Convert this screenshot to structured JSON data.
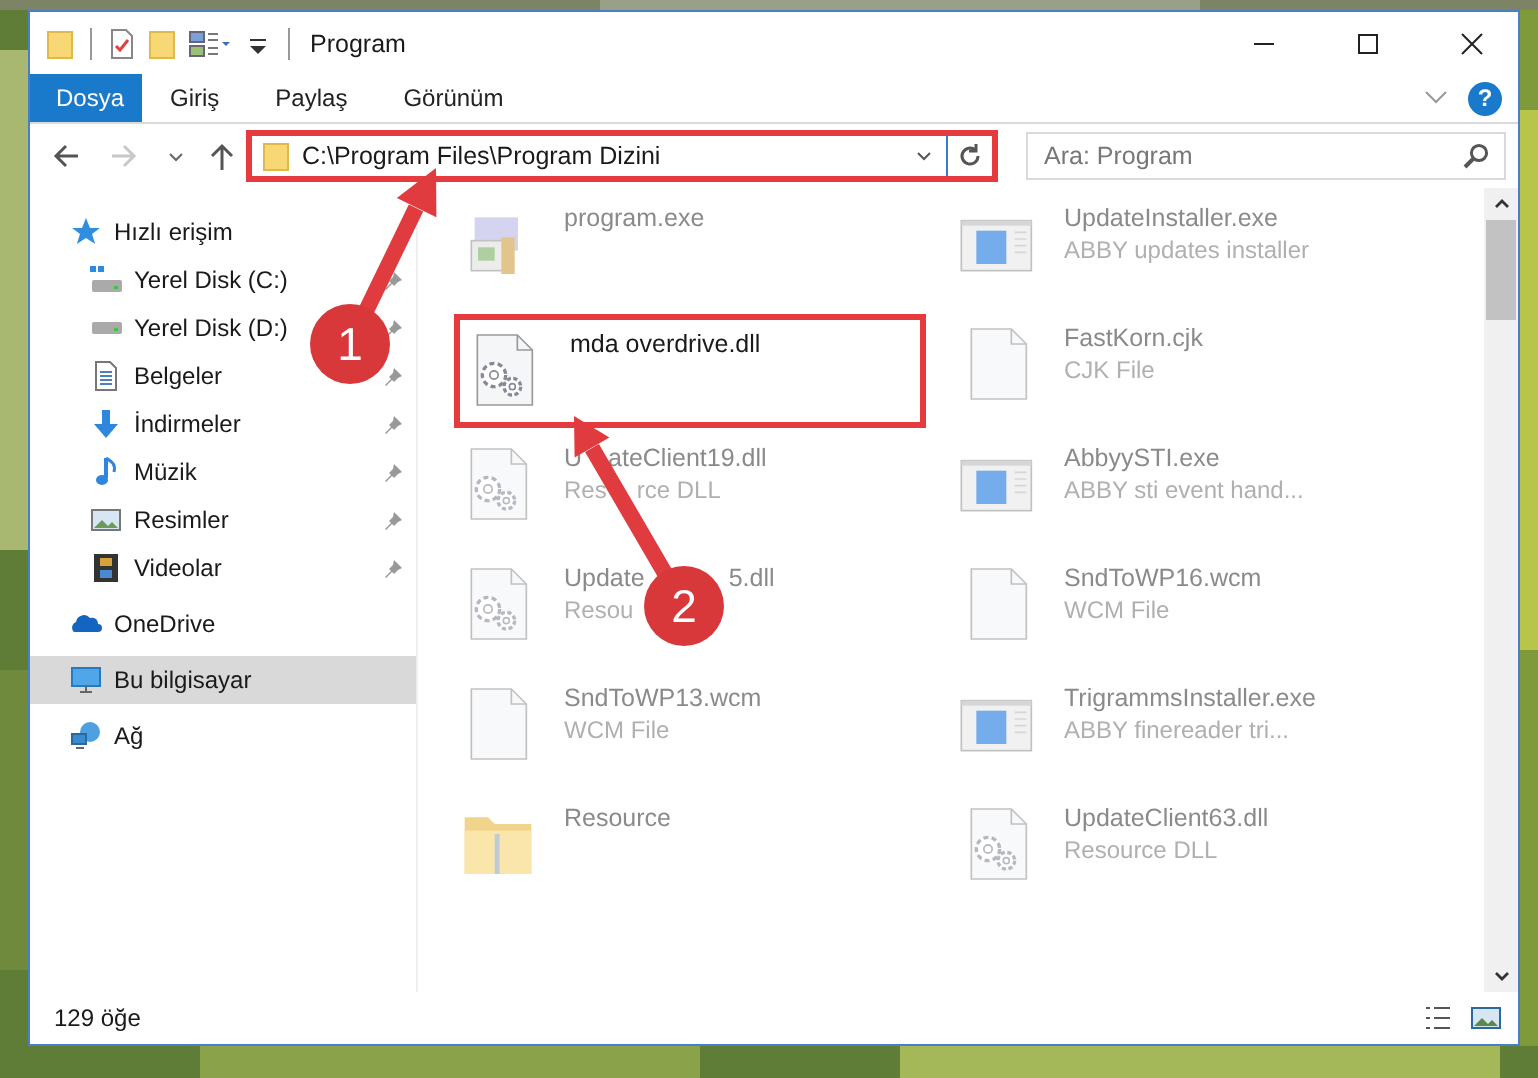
{
  "window": {
    "title": "Program"
  },
  "ribbon": {
    "tabs": [
      {
        "label": "Dosya",
        "selected": true
      },
      {
        "label": "Giriş",
        "selected": false
      },
      {
        "label": "Paylaş",
        "selected": false
      },
      {
        "label": "Görünüm",
        "selected": false
      }
    ],
    "help": "?"
  },
  "address_bar": {
    "path": "C:\\Program Files\\Program Dizini",
    "highlighted": true
  },
  "search": {
    "placeholder": "Ara: Program"
  },
  "sidebar": {
    "items": [
      {
        "label": "Hızlı erişim",
        "kind": "star",
        "selected": false,
        "children": [
          {
            "label": "Yerel Disk (C:)",
            "kind": "drive-windows",
            "pinned": true,
            "selected": false
          },
          {
            "label": "Yerel Disk (D:)",
            "kind": "drive",
            "pinned": true,
            "selected": false
          },
          {
            "label": "Belgeler",
            "kind": "documents",
            "pinned": true,
            "selected": false
          },
          {
            "label": "İndirmeler",
            "kind": "download",
            "pinned": true,
            "selected": false
          },
          {
            "label": "Müzik",
            "kind": "music",
            "pinned": true,
            "selected": false
          },
          {
            "label": "Resimler",
            "kind": "pictures",
            "pinned": true,
            "selected": false
          },
          {
            "label": "Videolar",
            "kind": "videos",
            "pinned": true,
            "selected": false
          }
        ]
      },
      {
        "label": "OneDrive",
        "kind": "cloud",
        "selected": false
      },
      {
        "label": "Bu bilgisayar",
        "kind": "computer",
        "selected": true
      },
      {
        "label": "Ağ",
        "kind": "network",
        "selected": false
      }
    ]
  },
  "files": [
    {
      "name": "program.exe",
      "kind": "program",
      "dimmed": true,
      "highlighted": false
    },
    {
      "name": "UpdateInstaller.exe",
      "description": "ABBY updates installer",
      "kind": "window-app",
      "dimmed": true,
      "highlighted": false
    },
    {
      "name": "mda overdrive.dll",
      "kind": "gear-file",
      "dimmed": false,
      "highlighted": true
    },
    {
      "name": "FastKorn.cjk",
      "description": "CJK File",
      "kind": "blank-file",
      "dimmed": true,
      "highlighted": false
    },
    {
      "name": [
        "U",
        "ateClient19.dll"
      ],
      "description": [
        "Res",
        "rce DLL"
      ],
      "kind": "gear-file",
      "dimmed": true,
      "highlighted": false
    },
    {
      "name": "AbbyySTI.exe",
      "description": "ABBY sti event hand...",
      "kind": "window-app",
      "dimmed": true,
      "highlighted": false
    },
    {
      "name": [
        "Update",
        "5.dll"
      ],
      "description": [
        "Resou"
      ],
      "kind": "gear-file",
      "dimmed": true,
      "highlighted": false
    },
    {
      "name": "SndToWP16.wcm",
      "description": "WCM File",
      "kind": "blank-file",
      "dimmed": true,
      "highlighted": false
    },
    {
      "name": "SndToWP13.wcm",
      "description": "WCM File",
      "kind": "blank-file",
      "dimmed": true,
      "highlighted": false
    },
    {
      "name": "TrigrammsInstaller.exe",
      "description": "ABBY finereader tri...",
      "kind": "window-app",
      "dimmed": true,
      "highlighted": false
    },
    {
      "name": "Resource",
      "kind": "folder",
      "dimmed": true,
      "highlighted": false
    },
    {
      "name": "UpdateClient63.dll",
      "description": "Resource DLL",
      "kind": "gear-file",
      "dimmed": true,
      "highlighted": false
    }
  ],
  "annotations": [
    {
      "number": "1"
    },
    {
      "number": "2"
    }
  ],
  "status_bar": {
    "count": "129 öğe"
  }
}
